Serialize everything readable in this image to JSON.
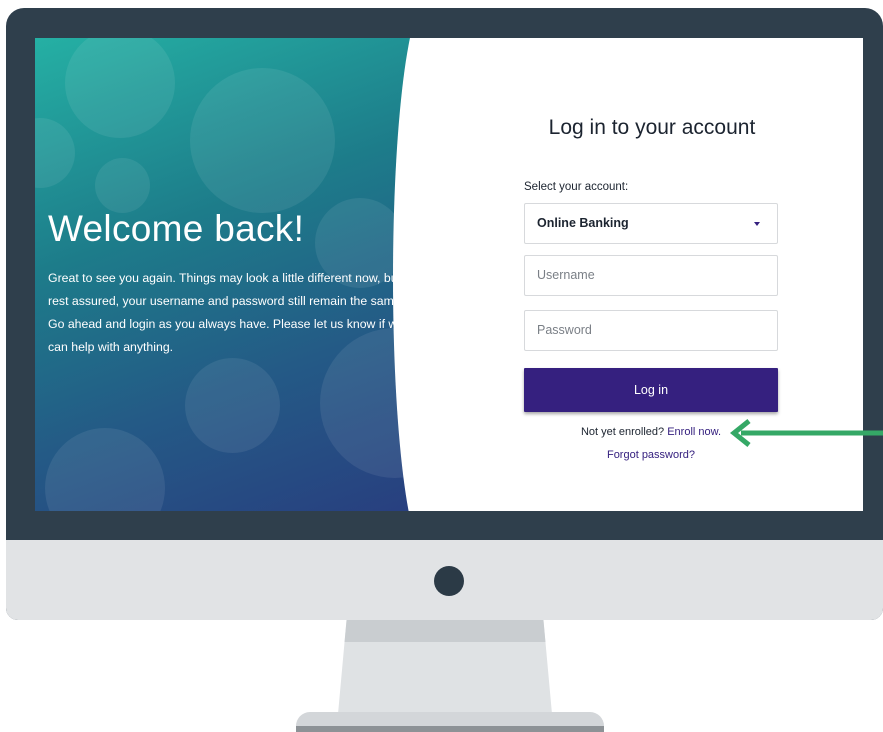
{
  "hero": {
    "title": "Welcome back!",
    "message": "Great to see you again. Things may look a little different now, but rest assured, your username and password still remain the same. Go ahead and login as you always have. Please let us know if we can help with anything."
  },
  "login": {
    "title": "Log in to your account",
    "select_label": "Select your account:",
    "selected_account": "Online Banking",
    "username_placeholder": "Username",
    "password_placeholder": "Password",
    "login_button": "Log in",
    "enroll_prompt": "Not yet enrolled?",
    "enroll_link": "Enroll now.",
    "forgot_link": "Forgot password?"
  },
  "colors": {
    "brand": "#35207f",
    "arrow": "#35a866",
    "bezel": "#2f3f4c"
  },
  "icons": {
    "caret": "chevron-down-icon",
    "arrow": "arrow-left-icon",
    "camera": "camera-dot"
  }
}
